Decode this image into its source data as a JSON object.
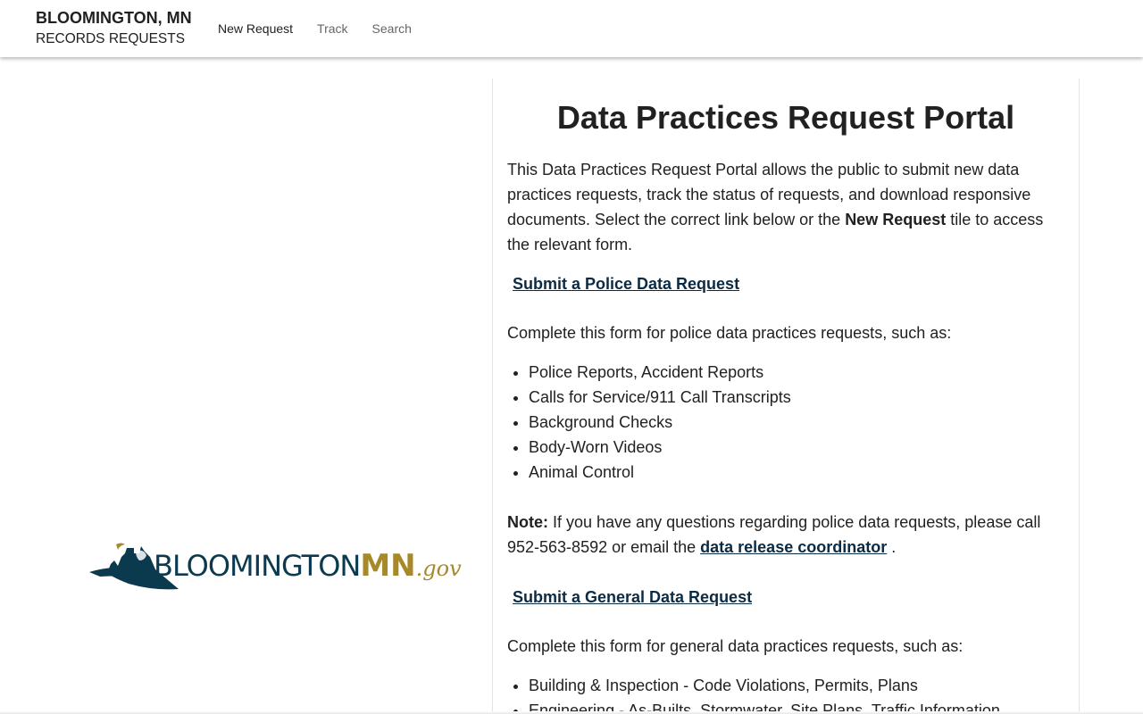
{
  "header": {
    "brand_title": "BLOOMINGTON, MN",
    "brand_subtitle": "RECORDS REQUESTS",
    "nav": [
      {
        "label": "New Request",
        "active": true
      },
      {
        "label": "Track",
        "active": false
      },
      {
        "label": "Search",
        "active": false
      }
    ]
  },
  "logo": {
    "word_blue": "BLOOMINGTON",
    "word_gold": "MN",
    "word_suffix": ".gov",
    "colors": {
      "navy": "#0b3a4f",
      "gold": "#a8892a"
    }
  },
  "main": {
    "title": "Data Practices Request Portal",
    "intro_part1": "This Data Practices Request Portal allows the public to submit new data practices requests, track the status of requests, and download responsive documents. Select the correct link below or the ",
    "intro_bold": "New Request",
    "intro_part2": " tile to access the relevant form.",
    "police": {
      "link": "Submit a Police Data Request",
      "desc": "Complete this form for police data practices requests, such as:",
      "items": [
        "Police Reports, Accident Reports",
        "Calls for Service/911 Call Transcripts",
        "Background Checks",
        "Body-Worn Videos",
        "Animal Control"
      ],
      "note_label": "Note:",
      "note_text": " If you have any questions regarding police data requests, please call 952-563-8592 or email the ",
      "note_link": "data release coordinator",
      "note_end": " ."
    },
    "general": {
      "link": "Submit a General Data Request",
      "desc": "Complete this form for general data practices requests, such as:",
      "items": [
        "Building & Inspection - Code Violations, Permits, Plans",
        "Engineering - As-Builts, Stormwater, Site Plans, Traffic Information"
      ]
    }
  },
  "colors": {
    "link": "#0b2b44",
    "text": "#212121",
    "nav_inactive": "#666666"
  }
}
